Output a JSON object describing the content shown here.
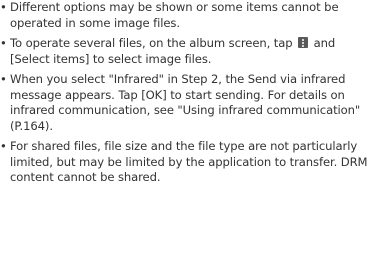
{
  "bullet": "•",
  "notes": [
    {
      "text": "Different options may be shown or some items cannot be operated in some image files."
    },
    {
      "before_icon": "To operate several files, on the album screen, tap ",
      "after_icon": " and [Select items] to select image files.",
      "icon": "menu-icon"
    },
    {
      "text": "When you select \"Infrared\" in Step 2, the Send via infrared message appears. Tap [OK] to start sending. For details on infrared communication, see \"Using infrared communication\" (P.164)."
    },
    {
      "text": "For shared files, file size and the file type are not particularly limited, but may be limited by the application to transfer. DRM content cannot be shared."
    }
  ],
  "colors": {
    "text": "#333333",
    "icon": "#5a5a5a"
  }
}
